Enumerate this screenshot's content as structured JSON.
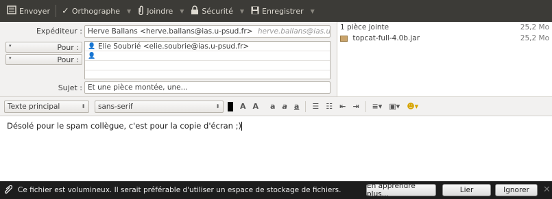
{
  "toolbar": {
    "send_label": "Envoyer",
    "spelling_label": "Orthographe",
    "attach_label": "Joindre",
    "security_label": "Sécurité",
    "save_label": "Enregistrer"
  },
  "header": {
    "from_label": "Expéditeur :",
    "from_value": "Herve Ballans <herve.ballans@ias.u-psud.fr>",
    "from_hint": "herve.ballans@ias.u-p...",
    "recipients": [
      {
        "type": "Pour :",
        "value": "Elie Soubrié <elie.soubrie@ias.u-psud.fr>"
      },
      {
        "type": "Pour :",
        "value": ""
      }
    ],
    "subject_label": "Sujet :",
    "subject_value": "Et une pièce montée, une..."
  },
  "attachments": {
    "summary_label": "1 pièce jointe",
    "summary_size": "25,2 Mo",
    "items": [
      {
        "name": "topcat-full-4.0b.jar",
        "size": "25,2 Mo"
      }
    ]
  },
  "format": {
    "paragraph_style": "Texte principal",
    "font_family": "sans-serif"
  },
  "body": {
    "text": "Désolé pour le spam collègue, c'est pour la copie d'écran ;)"
  },
  "notification": {
    "message": "Ce fichier est volumineux. Il serait préférable d'utiliser un espace de stockage de fichiers.",
    "learn_more_label": "En apprendre plus...",
    "link_label": "Lier",
    "ignore_label": "Ignorer"
  }
}
